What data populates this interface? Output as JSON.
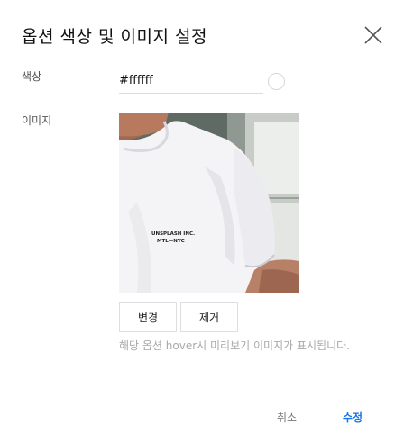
{
  "dialog": {
    "title": "옵션 색상 및 이미지 설정"
  },
  "color": {
    "label": "색상",
    "value": "#ffffff",
    "swatch_color": "#ffffff"
  },
  "image": {
    "label": "이미지",
    "shirt_text_line1": "UNSPLASH INC.",
    "shirt_text_line2": "MTL—NYC",
    "change_label": "변경",
    "remove_label": "제거",
    "helper_text": "해당 옵션 hover시 미리보기 이미지가 표시됩니다."
  },
  "footer": {
    "cancel_label": "취소",
    "submit_label": "수정"
  },
  "colors": {
    "accent": "#1a73e8",
    "helper": "#a8a8a8"
  },
  "icons": {
    "close": "close-icon"
  }
}
